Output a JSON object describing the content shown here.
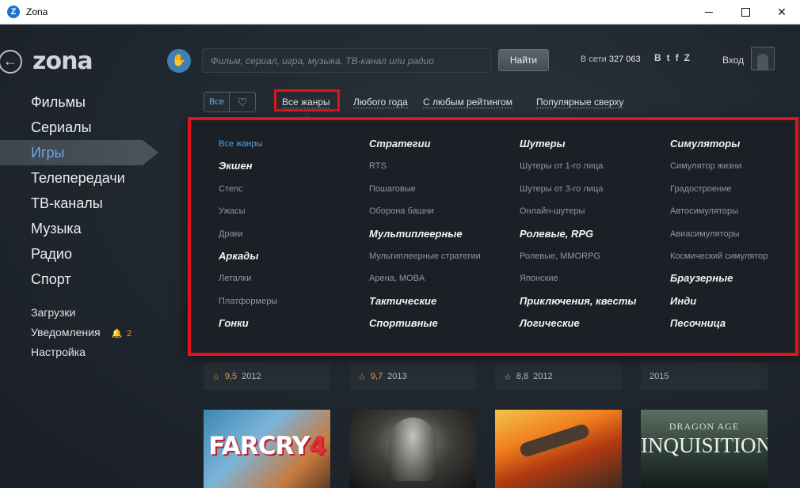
{
  "window": {
    "title": "Zona",
    "app_icon": "Z"
  },
  "header": {
    "logo": "zona",
    "search_placeholder": "Фильм, сериал, игра, музыка, ТВ-канал или радио",
    "search_button": "Найти",
    "online_label": "В сети",
    "online_count": "327 063",
    "social": [
      "B",
      "t",
      "f",
      "Z"
    ],
    "login": "Вход"
  },
  "sidebar": {
    "items": [
      {
        "label": "Фильмы"
      },
      {
        "label": "Сериалы"
      },
      {
        "label": "Игры",
        "active": true
      },
      {
        "label": "Телепередачи"
      },
      {
        "label": "ТВ-каналы"
      },
      {
        "label": "Музыка"
      },
      {
        "label": "Радио"
      },
      {
        "label": "Спорт"
      }
    ],
    "secondary": [
      {
        "label": "Загрузки"
      },
      {
        "label": "Уведомления",
        "badge": "2"
      },
      {
        "label": "Настройка"
      }
    ]
  },
  "filters": {
    "all_toggle": "Все",
    "genres": "Все жанры",
    "year": "Любого года",
    "rating": "С любым рейтингом",
    "sort": "Популярные сверху"
  },
  "genre_columns": [
    [
      {
        "label": "Все жанры",
        "style": "selected"
      },
      {
        "label": "Экшен",
        "style": "head"
      },
      {
        "label": "Стелс",
        "style": "item"
      },
      {
        "label": "Ужасы",
        "style": "item"
      },
      {
        "label": "Драки",
        "style": "item"
      },
      {
        "label": "Аркады",
        "style": "head"
      },
      {
        "label": "Леталки",
        "style": "item"
      },
      {
        "label": "Платформеры",
        "style": "item"
      },
      {
        "label": "Гонки",
        "style": "head"
      }
    ],
    [
      {
        "label": "Стратегии",
        "style": "head"
      },
      {
        "label": "RTS",
        "style": "item"
      },
      {
        "label": "Пошаговые",
        "style": "item"
      },
      {
        "label": "Оборона башни",
        "style": "item"
      },
      {
        "label": "Мультиплеерные",
        "style": "head"
      },
      {
        "label": "Мультиплеерные стратегии",
        "style": "item"
      },
      {
        "label": "Арена, MOBA",
        "style": "item"
      },
      {
        "label": "Тактические",
        "style": "head"
      },
      {
        "label": "Спортивные",
        "style": "head"
      }
    ],
    [
      {
        "label": "Шутеры",
        "style": "head"
      },
      {
        "label": "Шутеры от 1-го лица",
        "style": "item"
      },
      {
        "label": "Шутеры от 3-го лица",
        "style": "item"
      },
      {
        "label": "Онлайн-шутеры",
        "style": "item"
      },
      {
        "label": "Ролевые, RPG",
        "style": "head"
      },
      {
        "label": "Ролевые, MMORPG",
        "style": "item"
      },
      {
        "label": "Японские",
        "style": "item"
      },
      {
        "label": "Приключения, квесты",
        "style": "head"
      },
      {
        "label": "Логические",
        "style": "head"
      }
    ],
    [
      {
        "label": "Симуляторы",
        "style": "head"
      },
      {
        "label": "Симулятор жизни",
        "style": "item"
      },
      {
        "label": "Градостроение",
        "style": "item"
      },
      {
        "label": "Автосимуляторы",
        "style": "item"
      },
      {
        "label": "Авиасимуляторы",
        "style": "item"
      },
      {
        "label": "Космический симулятор",
        "style": "item"
      },
      {
        "label": "Браузерные",
        "style": "head"
      },
      {
        "label": "Инди",
        "style": "head"
      },
      {
        "label": "Песочница",
        "style": "head"
      }
    ]
  ],
  "cards_row1": [
    {
      "rating": "9,5",
      "year": "2012",
      "rating_color": "orange"
    },
    {
      "rating": "9,7",
      "year": "2013",
      "rating_color": "orange"
    },
    {
      "rating": "8,8",
      "year": "2012",
      "rating_color": "grey"
    },
    {
      "rating": "",
      "year": "2015",
      "rating_color": "none"
    }
  ],
  "covers": {
    "farcry_main": "FARCRY",
    "farcry_num": "4",
    "dragon_age_top": "DRAGON AGE",
    "dragon_age_title": "INQUISITION"
  },
  "colors": {
    "accent_blue": "#4fa1e6",
    "highlight_red": "#e0141b",
    "rating_orange": "#e0a142"
  }
}
